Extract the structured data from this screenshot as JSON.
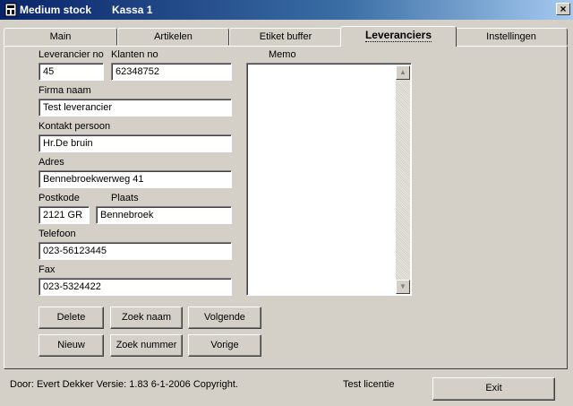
{
  "window": {
    "title": "Medium stock",
    "subtitle": "Kassa 1",
    "close_glyph": "×"
  },
  "tabs": [
    {
      "label": "Main"
    },
    {
      "label": "Artikelen"
    },
    {
      "label": "Etiket buffer"
    },
    {
      "label": "Leveranciers",
      "active": true
    },
    {
      "label": "Instellingen"
    }
  ],
  "form": {
    "leverancier_no": {
      "label": "Leverancier no",
      "value": "45"
    },
    "klanten_no": {
      "label": "Klanten no",
      "value": "62348752"
    },
    "firma_naam": {
      "label": "Firma naam",
      "value": "Test leverancier"
    },
    "kontakt_persoon": {
      "label": "Kontakt persoon",
      "value": "Hr.De bruin"
    },
    "adres": {
      "label": "Adres",
      "value": "Bennebroekwerweg 41"
    },
    "postkode": {
      "label": "Postkode",
      "value": "2121 GR"
    },
    "plaats": {
      "label": "Plaats",
      "value": "Bennebroek"
    },
    "telefoon": {
      "label": "Telefoon",
      "value": "023-56123445"
    },
    "fax": {
      "label": "Fax",
      "value": "023-5324422"
    },
    "memo": {
      "label": "Memo",
      "value": ""
    }
  },
  "buttons": {
    "delete": "Delete",
    "zoek_naam": "Zoek naam",
    "volgende": "Volgende",
    "nieuw": "Nieuw",
    "zoek_nummer": "Zoek nummer",
    "vorige": "Vorige",
    "exit": "Exit"
  },
  "status": {
    "copyright": "Door: Evert Dekker Versie: 1.83  6-1-2006 Copyright.",
    "license": "Test licentie"
  },
  "colors": {
    "face": "#d4d0c8",
    "title_start": "#0a246a",
    "title_end": "#a6caf0"
  }
}
